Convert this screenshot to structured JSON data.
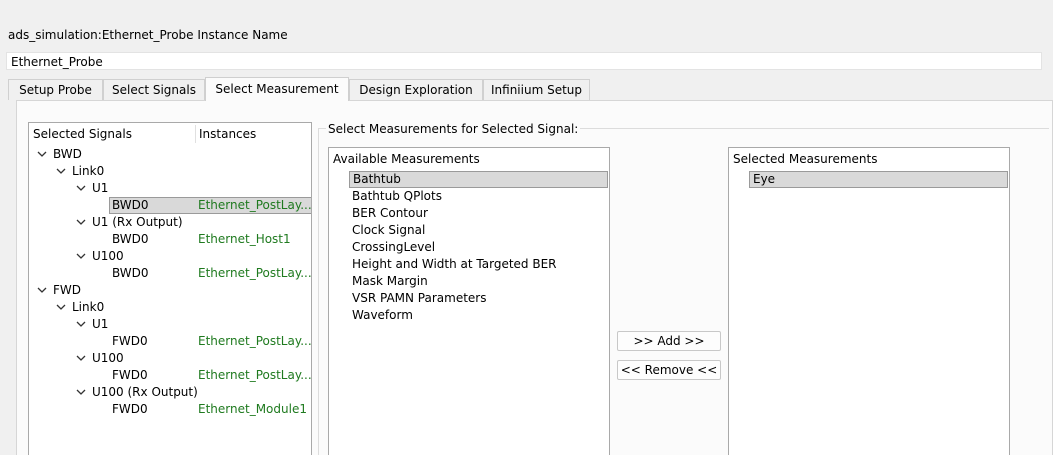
{
  "instance": {
    "label": "ads_simulation:Ethernet_Probe Instance Name",
    "value": "Ethernet_Probe"
  },
  "tabs": [
    {
      "label": "Setup Probe"
    },
    {
      "label": "Select Signals"
    },
    {
      "label": "Select Measurement",
      "active": true
    },
    {
      "label": "Design Exploration"
    },
    {
      "label": "Infiniium Setup"
    }
  ],
  "signals": {
    "col_signals": "Selected Signals",
    "col_instances": "Instances",
    "rows": [
      {
        "name": "BWD",
        "instance": ""
      },
      {
        "name": "Link0",
        "instance": ""
      },
      {
        "name": "U1",
        "instance": ""
      },
      {
        "name": "BWD0",
        "instance": "Ethernet_PostLay..."
      },
      {
        "name": "U1 (Rx Output)",
        "instance": ""
      },
      {
        "name": "BWD0",
        "instance": "Ethernet_Host1"
      },
      {
        "name": "U100",
        "instance": ""
      },
      {
        "name": "BWD0",
        "instance": "Ethernet_PostLay..."
      },
      {
        "name": "FWD",
        "instance": ""
      },
      {
        "name": "Link0",
        "instance": ""
      },
      {
        "name": "U1",
        "instance": ""
      },
      {
        "name": "FWD0",
        "instance": "Ethernet_PostLay..."
      },
      {
        "name": "U100",
        "instance": ""
      },
      {
        "name": "FWD0",
        "instance": "Ethernet_PostLay..."
      },
      {
        "name": "U100 (Rx Output)",
        "instance": ""
      },
      {
        "name": "FWD0",
        "instance": "Ethernet_Module1"
      }
    ]
  },
  "measurements": {
    "group_title": "Select Measurements for Selected Signal:",
    "available_header": "Available Measurements",
    "available": [
      "Bathtub",
      "Bathtub QPlots",
      "BER Contour",
      "Clock Signal",
      "CrossingLevel",
      "Height and Width at Targeted BER",
      "Mask Margin",
      "VSR PAMN Parameters",
      "Waveform"
    ],
    "available_selected": "Bathtub",
    "selected_header": "Selected Measurements",
    "selected": [
      "Eye"
    ],
    "add_label": ">> Add >>",
    "remove_label": "<< Remove <<"
  },
  "colors": {
    "instance_text": "#1f7a1f",
    "selection_bg": "#d9d9d9"
  }
}
